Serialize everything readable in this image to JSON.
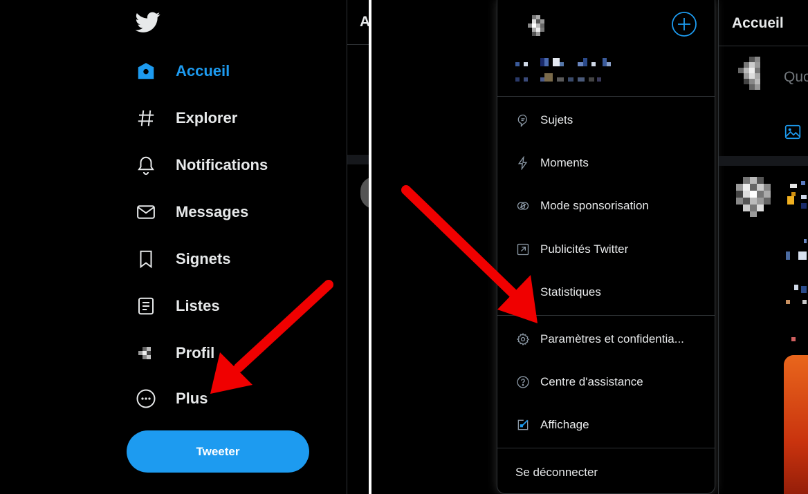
{
  "left_panel": {
    "nav": [
      {
        "label": "Accueil",
        "icon": "home-icon",
        "active": true
      },
      {
        "label": "Explorer",
        "icon": "hashtag-icon"
      },
      {
        "label": "Notifications",
        "icon": "bell-icon"
      },
      {
        "label": "Messages",
        "icon": "envelope-icon"
      },
      {
        "label": "Signets",
        "icon": "bookmark-icon"
      },
      {
        "label": "Listes",
        "icon": "list-icon"
      },
      {
        "label": "Profil",
        "icon": "avatar"
      },
      {
        "label": "Plus",
        "icon": "more-circle-icon"
      }
    ],
    "tweet_button": "Tweeter",
    "timeline_header_fragment": "A"
  },
  "right_panel": {
    "menu_items": [
      {
        "label": "Sujets",
        "icon": "topics-icon"
      },
      {
        "label": "Moments",
        "icon": "lightning-icon"
      },
      {
        "label": "Mode sponsorisation",
        "icon": "sponsor-icon"
      },
      {
        "label": "Publicités Twitter",
        "icon": "external-arrow-icon"
      },
      {
        "label": "Statistiques",
        "icon": "stats-icon"
      },
      {
        "label": "Paramètres et confidentia...",
        "icon": "gear-icon"
      },
      {
        "label": "Centre d'assistance",
        "icon": "help-icon"
      },
      {
        "label": "Affichage",
        "icon": "display-icon"
      }
    ],
    "logout": "Se déconnecter",
    "timeline_header": "Accueil",
    "compose_placeholder_fragment": "Quo"
  },
  "colors": {
    "accent": "#1d9bf0",
    "annotation_arrow": "#f00000"
  }
}
